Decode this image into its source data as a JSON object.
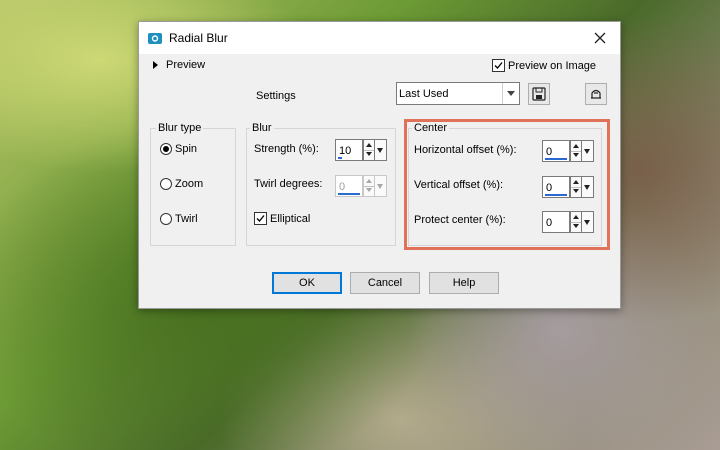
{
  "window": {
    "title": "Radial Blur"
  },
  "preview": {
    "label": "Preview",
    "on_image_label": "Preview on Image",
    "on_image_checked": true
  },
  "settings": {
    "label": "Settings",
    "preset_value": "Last Used"
  },
  "blur_type": {
    "title": "Blur type",
    "options": [
      {
        "label": "Spin",
        "selected": true
      },
      {
        "label": "Zoom",
        "selected": false
      },
      {
        "label": "Twirl",
        "selected": false
      }
    ]
  },
  "blur": {
    "title": "Blur",
    "strength_label": "Strength (%):",
    "strength_value": "10",
    "twirl_label": "Twirl degrees:",
    "twirl_value": "0",
    "elliptical_label": "Elliptical",
    "elliptical_checked": true
  },
  "center": {
    "title": "Center",
    "horizontal_label": "Horizontal offset (%):",
    "horizontal_value": "0",
    "vertical_label": "Vertical offset (%):",
    "vertical_value": "0",
    "protect_label": "Protect center (%):",
    "protect_value": "0"
  },
  "buttons": {
    "ok": "OK",
    "cancel": "Cancel",
    "help": "Help"
  },
  "colors": {
    "highlight": "#e0725a",
    "accent": "#0078d7",
    "icon": "#1e8fbf"
  }
}
